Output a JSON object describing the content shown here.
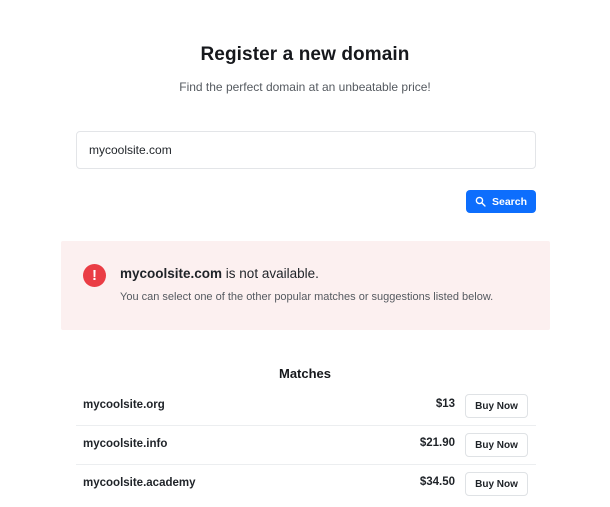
{
  "header": {
    "title": "Register a new domain",
    "subtitle": "Find the perfect domain at an unbeatable price!"
  },
  "search": {
    "value": "mycoolsite.com",
    "button_label": "Search",
    "button_icon": "search-icon"
  },
  "alert": {
    "icon": "exclamation-icon",
    "domain": "mycoolsite.com",
    "status_text": " is not available.",
    "message": "You can select one of the other popular matches or suggestions listed below.",
    "colors": {
      "background": "#fcf0f0",
      "icon": "#ea3d45"
    }
  },
  "matches": {
    "heading": "Matches",
    "rows": [
      {
        "domain": "mycoolsite.org",
        "price": "$13",
        "button_label": "Buy Now"
      },
      {
        "domain": "mycoolsite.info",
        "price": "$21.90",
        "button_label": "Buy Now"
      },
      {
        "domain": "mycoolsite.academy",
        "price": "$34.50",
        "button_label": "Buy Now"
      }
    ]
  },
  "colors": {
    "accent": "#0d6efd"
  }
}
